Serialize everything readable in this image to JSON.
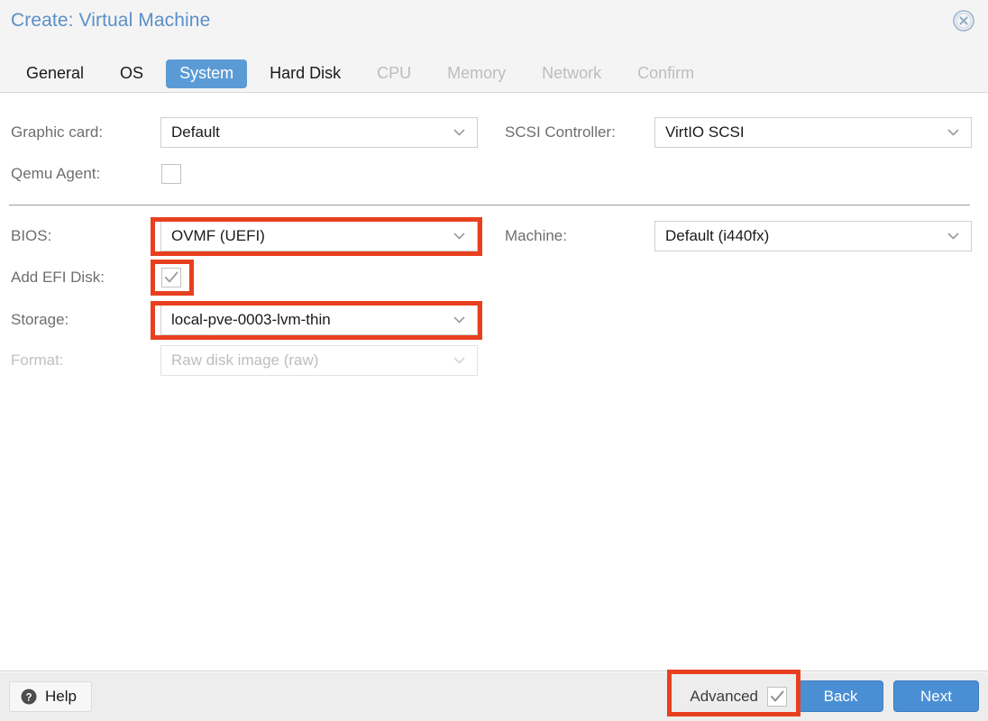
{
  "dialog": {
    "title": "Create: Virtual Machine",
    "close_icon": "close-circle-icon"
  },
  "tabs": [
    {
      "label": "General",
      "state": "inactive"
    },
    {
      "label": "OS",
      "state": "inactive"
    },
    {
      "label": "System",
      "state": "active"
    },
    {
      "label": "Hard Disk",
      "state": "inactive"
    },
    {
      "label": "CPU",
      "state": "disabled"
    },
    {
      "label": "Memory",
      "state": "disabled"
    },
    {
      "label": "Network",
      "state": "disabled"
    },
    {
      "label": "Confirm",
      "state": "disabled"
    }
  ],
  "form": {
    "graphic_card": {
      "label": "Graphic card:",
      "value": "Default"
    },
    "qemu_agent": {
      "label": "Qemu Agent:",
      "checked": false
    },
    "scsi_controller": {
      "label": "SCSI Controller:",
      "value": "VirtIO SCSI"
    },
    "bios": {
      "label": "BIOS:",
      "value": "OVMF (UEFI)",
      "highlighted": true
    },
    "add_efi_disk": {
      "label": "Add EFI Disk:",
      "checked": true,
      "highlighted": true
    },
    "storage": {
      "label": "Storage:",
      "value": "local-pve-0003-lvm-thin",
      "highlighted": true
    },
    "format": {
      "label": "Format:",
      "value": "Raw disk image (raw)",
      "disabled": true
    },
    "machine": {
      "label": "Machine:",
      "value": "Default (i440fx)"
    }
  },
  "footer": {
    "help_label": "Help",
    "help_icon": "question-mark-circle-icon",
    "advanced_label": "Advanced",
    "advanced_checked": true,
    "advanced_highlighted": true,
    "back_label": "Back",
    "next_label": "Next"
  },
  "colors": {
    "accent_blue": "#4a8fd4",
    "title_blue": "#5a8fc8",
    "annotation_red": "#e8401f",
    "header_bg": "#f4f4f4",
    "footer_bg": "#ededed"
  }
}
